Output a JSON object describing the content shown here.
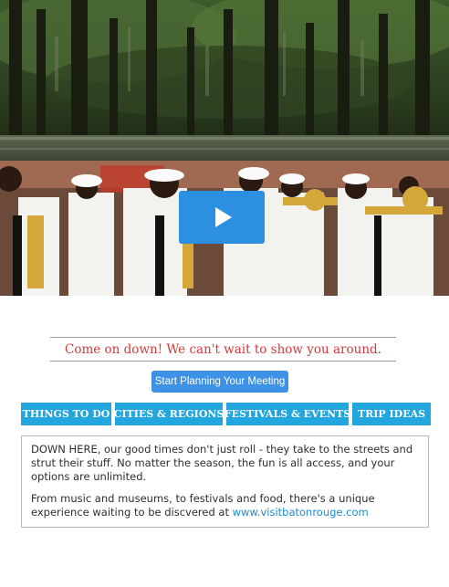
{
  "video": {
    "play_icon": "play-icon",
    "play_button_color": "#2c8fe0"
  },
  "tagline": "Come on down! We can't wait to show you around.",
  "cta": {
    "label": "Start Planning Your Meeting",
    "color": "#3d92e6"
  },
  "nav": {
    "color": "#22a6dd",
    "items": [
      {
        "label": "THINGS TO DO"
      },
      {
        "label": "CITIES & REGIONS"
      },
      {
        "label": "FESTIVALS & EVENTS"
      },
      {
        "label": "TRIP IDEAS"
      }
    ]
  },
  "intro": {
    "paragraph1": "DOWN HERE, our good times don't just roll - they take to the streets and strut their stuff. No matter the season, the fun is all access, and your options are unlimited.",
    "paragraph2_text": "From music and museums, to festivals and food, there's a unique experience waiting to be discvered at",
    "link_text": "www.visitbatonrouge.com"
  }
}
